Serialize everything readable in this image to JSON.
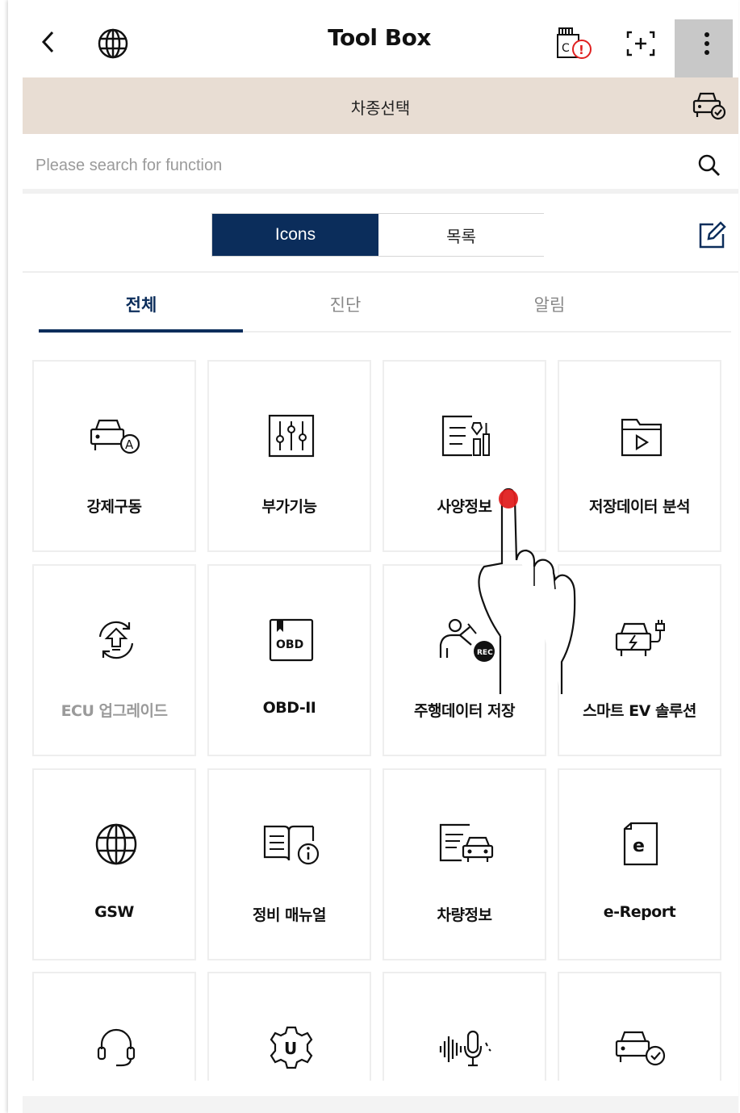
{
  "header": {
    "title": "Tool Box",
    "back_icon": "chevron-left-icon",
    "globe_icon": "globe-icon",
    "alert_icon": "device-alert-icon",
    "add_icon": "add-bracket-icon",
    "more_icon": "more-vertical-icon"
  },
  "vehicle_bar": {
    "label": "차종선택",
    "icon": "car-check-icon"
  },
  "search": {
    "placeholder": "Please search for function",
    "icon": "search-icon"
  },
  "view_toggle": {
    "icons_label": "Icons",
    "list_label": "목록",
    "selected": "Icons",
    "edit_icon": "edit-icon"
  },
  "tabs": [
    {
      "label": "전체",
      "active": true
    },
    {
      "label": "진단",
      "active": false
    },
    {
      "label": "알림",
      "active": false
    }
  ],
  "tiles": [
    {
      "label": "강제구동",
      "icon": "car-auto-icon",
      "enabled": true
    },
    {
      "label": "부가기능",
      "icon": "sliders-icon",
      "enabled": true
    },
    {
      "label": "사양정보",
      "icon": "spec-tools-icon",
      "enabled": true
    },
    {
      "label": "저장데이터 분석",
      "icon": "folder-play-icon",
      "enabled": true
    },
    {
      "label": "ECU 업그레이드",
      "icon": "ecu-upgrade-icon",
      "enabled": false
    },
    {
      "label": "OBD-II",
      "icon": "obd-book-icon",
      "enabled": true
    },
    {
      "label": "주행데이터 저장",
      "icon": "driving-record-icon",
      "enabled": true
    },
    {
      "label": "스마트 EV 솔루션",
      "icon": "ev-charge-icon",
      "enabled": true
    },
    {
      "label": "GSW",
      "icon": "globe-icon",
      "enabled": true
    },
    {
      "label": "정비 매뉴얼",
      "icon": "manual-info-icon",
      "enabled": true
    },
    {
      "label": "차량정보",
      "icon": "vehicle-info-icon",
      "enabled": true
    },
    {
      "label": "e-Report",
      "icon": "e-report-icon",
      "enabled": true
    },
    {
      "label": "",
      "icon": "headset-icon",
      "enabled": true
    },
    {
      "label": "",
      "icon": "gear-u-icon",
      "enabled": true
    },
    {
      "label": "",
      "icon": "voice-mic-icon",
      "enabled": true
    },
    {
      "label": "",
      "icon": "car-check-icon",
      "enabled": true
    }
  ],
  "colors": {
    "primary": "#0b2d5b",
    "vehicle_bar": "#e8ddd3",
    "touch": "#e02020"
  }
}
